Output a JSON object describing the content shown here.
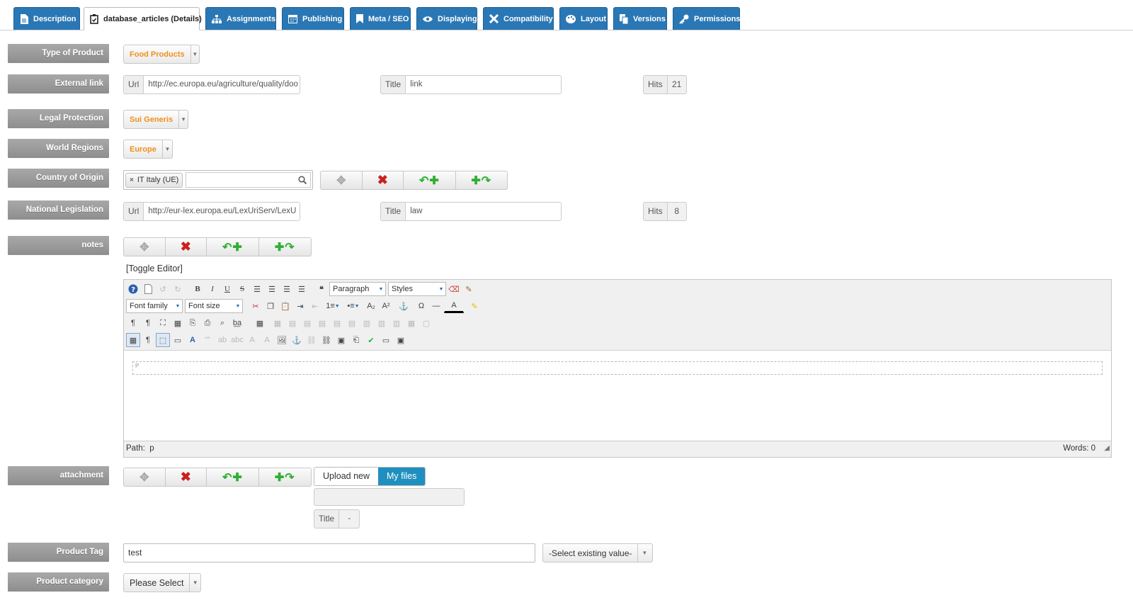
{
  "tabs": [
    {
      "label": "Description",
      "icon": "document-icon",
      "active": false
    },
    {
      "label": "database_articles (Details)",
      "icon": "clipboard-check-icon",
      "active": true
    },
    {
      "label": "Assignments",
      "icon": "sitemap-icon",
      "active": false
    },
    {
      "label": "Publishing",
      "icon": "calendar-icon",
      "active": false
    },
    {
      "label": "Meta / SEO",
      "icon": "bookmark-icon",
      "active": false
    },
    {
      "label": "Displaying",
      "icon": "eye-icon",
      "active": false
    },
    {
      "label": "Compatibility",
      "icon": "puzzle-icon",
      "active": false
    },
    {
      "label": "Layout",
      "icon": "palette-icon",
      "active": false
    },
    {
      "label": "Versions",
      "icon": "copy-icon",
      "active": false
    },
    {
      "label": "Permissions",
      "icon": "key-icon",
      "active": false
    }
  ],
  "fields": {
    "type_of_product": {
      "label": "Type of Product",
      "value": "Food Products"
    },
    "external_link": {
      "label": "External link",
      "url_label": "Url",
      "url": "http://ec.europa.eu/agriculture/quality/doo",
      "title_label": "Title",
      "title": "link",
      "hits_label": "Hits",
      "hits": "21"
    },
    "legal_protection": {
      "label": "Legal Protection",
      "value": "Sui Generis"
    },
    "world_regions": {
      "label": "World Regions",
      "value": "Europe"
    },
    "country_of_origin": {
      "label": "Country of Origin",
      "chip": "IT Italy (UE)",
      "chip_remove": "×"
    },
    "national_legislation": {
      "label": "National Legislation",
      "url_label": "Url",
      "url": "http://eur-lex.europa.eu/LexUriServ/LexU",
      "title_label": "Title",
      "title": "law",
      "hits_label": "Hits",
      "hits": "8"
    },
    "notes": {
      "label": "notes"
    },
    "attachment": {
      "label": "attachment",
      "upload_new": "Upload new",
      "my_files": "My files",
      "title_label": "Title",
      "title_value": "-"
    },
    "product_tag": {
      "label": "Product Tag",
      "value": "test",
      "select": "-Select existing value-"
    },
    "product_category": {
      "label": "Product category",
      "value": "Please Select"
    }
  },
  "editor": {
    "toggle": "[Toggle Editor]",
    "paragraph": "Paragraph",
    "styles": "Styles",
    "font_family": "Font family",
    "font_size": "Font size",
    "block_marker": "P",
    "path_label": "Path:",
    "path_value": "p",
    "words": "Words: 0"
  },
  "colors": {
    "tab": "#2a77b5",
    "label_bg": "#999999",
    "accent_orange": "#f0901e",
    "my_files": "#1f8fbf",
    "delete": "#cc1f1f",
    "add": "#2db032"
  }
}
